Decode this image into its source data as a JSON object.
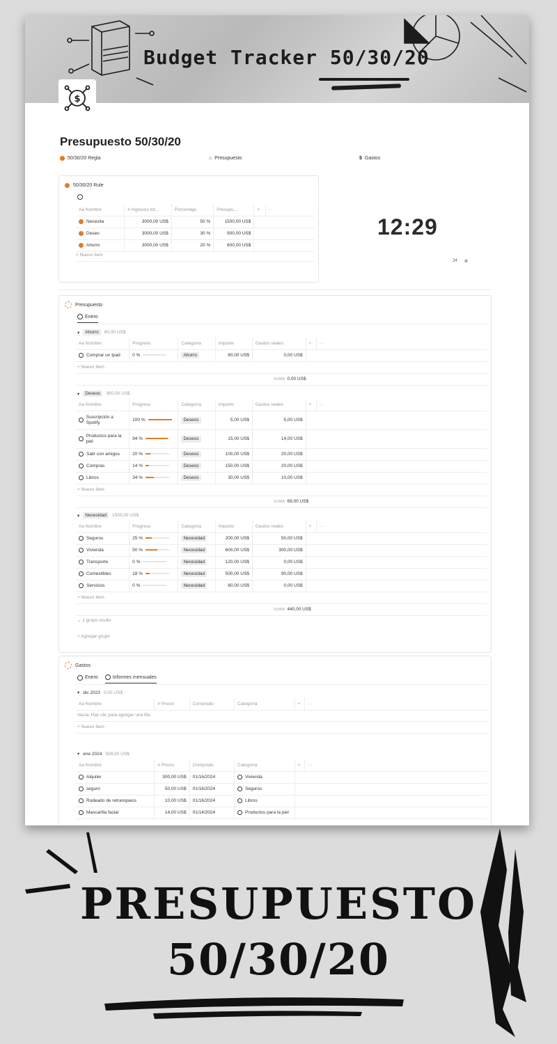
{
  "banner": {
    "title": "Budget Tracker 50/30/20"
  },
  "page": {
    "title": "Presupuesto 50/30/20"
  },
  "links": [
    {
      "label": "50/30/20 Regla",
      "icon": "orange-dot-icon"
    },
    {
      "label": "Presupuesto",
      "icon": "bank-icon"
    },
    {
      "label": "Gastos",
      "icon": "dollar-icon"
    }
  ],
  "rule": {
    "title": "50/30/20 Rule",
    "headers": [
      "Aa Nombre",
      "# Ingresos tot...",
      "Porcentaje",
      "Presupu...",
      "+",
      "···"
    ],
    "rows": [
      {
        "name": "Necesita",
        "income": "3000,00 US$",
        "pct": "50 %",
        "budget": "1500,00 US$"
      },
      {
        "name": "Deseo",
        "income": "3000,00 US$",
        "pct": "30 %",
        "budget": "900,00 US$"
      },
      {
        "name": "Ahorro",
        "income": "3000,00 US$",
        "pct": "20 %",
        "budget": "600,00 US$"
      }
    ],
    "new_item": "+ Nuevo ítem"
  },
  "clock": {
    "time": "12:29",
    "format": "24"
  },
  "presupuesto": {
    "title": "Presupuesto",
    "view": "Enero",
    "headers": [
      "Aa Nombre",
      "Progreso",
      "Categoría",
      "Importe",
      "Gastos reales",
      "+",
      "···"
    ],
    "new_item": "+ Nuevo ítem",
    "sum_label": "SUMA",
    "groups": [
      {
        "name": "Ahorro",
        "total": "80,00 US$",
        "sum": "0,00 US$",
        "rows": [
          {
            "name": "Comprar un Ipad",
            "progress": "0 %",
            "pct": 0,
            "cat": "Ahorro",
            "amount": "80,00 US$",
            "real": "0,00 US$"
          }
        ]
      },
      {
        "name": "Deseos",
        "total": "300,00 US$",
        "sum": "69,00 US$",
        "rows": [
          {
            "name": "Suscripción a Spotify",
            "progress": "100 %",
            "pct": 100,
            "cat": "Deseos",
            "amount": "5,00 US$",
            "real": "5,00 US$"
          },
          {
            "name": "Productos para la piel",
            "progress": "94 %",
            "pct": 94,
            "cat": "Deseos",
            "amount": "15,00 US$",
            "real": "14,00 US$"
          },
          {
            "name": "Salir con amigos",
            "progress": "20 %",
            "pct": 20,
            "cat": "Deseos",
            "amount": "100,00 US$",
            "real": "20,00 US$"
          },
          {
            "name": "Compras",
            "progress": "14 %",
            "pct": 14,
            "cat": "Deseos",
            "amount": "150,00 US$",
            "real": "20,00 US$"
          },
          {
            "name": "Libros",
            "progress": "34 %",
            "pct": 34,
            "cat": "Deseos",
            "amount": "30,00 US$",
            "real": "10,00 US$"
          }
        ]
      },
      {
        "name": "Necesidad",
        "total": "1500,00 US$",
        "sum": "440,00 US$",
        "rows": [
          {
            "name": "Seguros",
            "progress": "25 %",
            "pct": 25,
            "cat": "Necesidad",
            "amount": "200,00 US$",
            "real": "50,00 US$"
          },
          {
            "name": "Vivienda",
            "progress": "50 %",
            "pct": 50,
            "cat": "Necesidad",
            "amount": "600,00 US$",
            "real": "300,00 US$"
          },
          {
            "name": "Transporte",
            "progress": "0 %",
            "pct": 0,
            "cat": "Necesidad",
            "amount": "120,00 US$",
            "real": "0,00 US$"
          },
          {
            "name": "Comestibles",
            "progress": "18 %",
            "pct": 18,
            "cat": "Necesidad",
            "amount": "500,00 US$",
            "real": "90,00 US$"
          },
          {
            "name": "Servicios",
            "progress": "0 %",
            "pct": 0,
            "cat": "Necesidad",
            "amount": "80,00 US$",
            "real": "0,00 US$"
          }
        ]
      }
    ],
    "hidden_groups": "1 grupo oculto",
    "add_group": "+ Agregar grupo"
  },
  "gastos": {
    "title": "Gastos",
    "tabs": [
      "Enero",
      "Informes mensuales"
    ],
    "headers": [
      "Aa Nombre",
      "# Precio",
      "Comprado",
      "Categoría",
      "+",
      "···"
    ],
    "new_item": "+ Nuevo ítem",
    "empty": "Vacía. Haz clic para agregar una fila.",
    "groups": [
      {
        "name": "dic 2023",
        "total": "0,00 US$",
        "rows": []
      },
      {
        "name": "ene 2024",
        "total": "509,00 US$",
        "rows": [
          {
            "name": "Alquiler",
            "price": "300,00 US$",
            "date": "01/16/2024",
            "cat": "Vivienda"
          },
          {
            "name": "seguro",
            "price": "50,00 US$",
            "date": "01/16/2024",
            "cat": "Seguros"
          },
          {
            "name": "Rodeado de retranqueos",
            "price": "10,00 US$",
            "date": "01/16/2024",
            "cat": "Libros"
          },
          {
            "name": "Mascarilla facial",
            "price": "14,00 US$",
            "date": "01/14/2024",
            "cat": "Productos para la piel"
          }
        ]
      }
    ]
  },
  "poster": {
    "line1": "PRESUPUESTO",
    "line2": "50/30/20"
  }
}
